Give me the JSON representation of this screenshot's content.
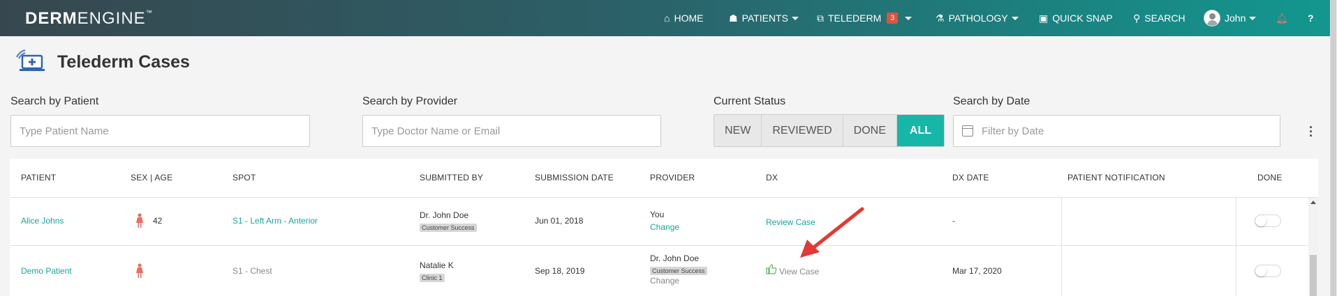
{
  "app": {
    "logo_bold": "DERM",
    "logo_thin": "ENGINE",
    "logo_tm": "™"
  },
  "nav": {
    "home": "HOME",
    "patients": "PATIENTS",
    "telederm": "TELEDERM",
    "telederm_badge": "3",
    "pathology": "PATHOLOGY",
    "quick_snap": "QUICK SNAP",
    "search": "SEARCH",
    "user": "John",
    "help": "?"
  },
  "page": {
    "title": "Telederm Cases"
  },
  "filters": {
    "patient_label": "Search by Patient",
    "patient_placeholder": "Type Patient Name",
    "provider_label": "Search by Provider",
    "provider_placeholder": "Type Doctor Name or Email",
    "status_label": "Current Status",
    "status_options": [
      "NEW",
      "REVIEWED",
      "DONE",
      "ALL"
    ],
    "status_selected": "ALL",
    "date_label": "Search by Date",
    "date_placeholder": "Filter by Date"
  },
  "table": {
    "headers": [
      "PATIENT",
      "SEX | AGE",
      "SPOT",
      "SUBMITTED BY",
      "SUBMISSION DATE",
      "PROVIDER",
      "DX",
      "DX DATE",
      "PATIENT NOTIFICATION",
      "DONE"
    ],
    "rows": [
      {
        "patient": "Alice Johns",
        "age": "42",
        "spot": "S1 - Left Arm - Anterior",
        "submitted_by": "Dr. John Doe",
        "submitted_tag": "Customer Success",
        "submission_date": "Jun 01, 2018",
        "provider": "You",
        "provider_action": "Change",
        "dx": "Review Case",
        "dx_date": "-",
        "done": false
      },
      {
        "patient": "Demo Patient",
        "age": "",
        "spot": "S1 - Chest",
        "submitted_by": "Natalie K",
        "submitted_tag": "Clinic 1",
        "submission_date": "Sep 18, 2019",
        "provider": "Dr. John Doe",
        "provider_tag": "Customer Success",
        "provider_action": "Change",
        "dx": "View Case",
        "dx_date": "Mar 17, 2020",
        "done": false
      }
    ]
  },
  "colors": {
    "accent": "#16b6a8",
    "link": "#13a89c",
    "female_icon": "#ef6a5f",
    "arrow": "#e53935",
    "badge": "#e0523c"
  }
}
